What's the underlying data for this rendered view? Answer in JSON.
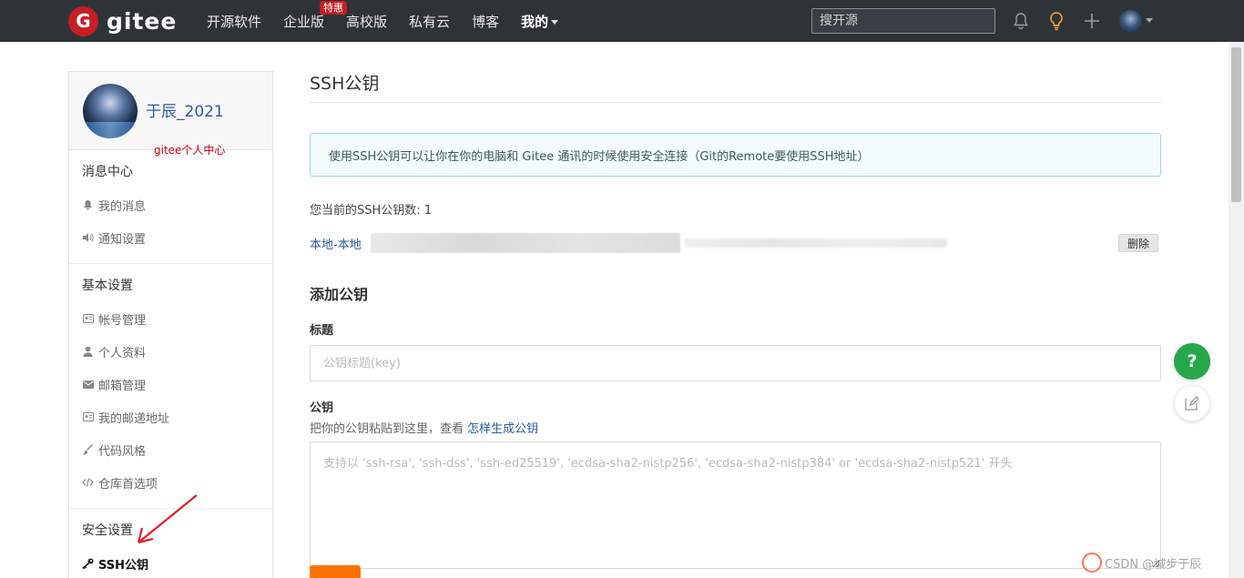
{
  "topbar": {
    "logo_text": "gitee",
    "logo_glyph": "G",
    "nav": [
      {
        "label": "开源软件"
      },
      {
        "label": "企业版",
        "badge": "特惠"
      },
      {
        "label": "高校版"
      },
      {
        "label": "私有云"
      },
      {
        "label": "博客"
      },
      {
        "label": "我的"
      }
    ],
    "search_placeholder": "搜开源",
    "icons": [
      "bell-icon",
      "lightbulb-icon",
      "plus-icon"
    ],
    "accent_color": "#c71d23"
  },
  "sidebar": {
    "username": "于辰_2021",
    "annotation": "gitee个人中心",
    "sections": [
      {
        "title": "消息中心",
        "items": [
          "我的消息",
          "通知设置"
        ]
      },
      {
        "title": "基本设置",
        "items": [
          "帐号管理",
          "个人资料",
          "邮箱管理",
          "我的邮递地址",
          "代码风格",
          "仓库首选项"
        ]
      },
      {
        "title": "安全设置",
        "items": [
          "SSH公钥"
        ]
      }
    ]
  },
  "main": {
    "title": "SSH公钥",
    "info": "使用SSH公钥可以让你在你的电脑和 Gitee 通讯的时候使用安全连接（Git的Remote要使用SSH地址）",
    "count_label": "您当前的SSH公钥数: 1",
    "key_name": "本地-本地",
    "delete_label": "删除",
    "add_title": "添加公钥",
    "title_label": "标题",
    "title_placeholder": "公钥标题(key)",
    "key_label": "公钥",
    "hint_text": "把你的公钥粘贴到这里，查看 ",
    "hint_link": "怎样生成公钥",
    "key_placeholder": "支持以 'ssh-rsa', 'ssh-dss', 'ssh-ed25519', 'ecdsa-sha2-nistp256', 'ecdsa-sha2-nistp384' or 'ecdsa-sha2-nistp521' 开头"
  },
  "floating": {
    "help_label": "?"
  },
  "watermark": "CSDN @城步于辰"
}
